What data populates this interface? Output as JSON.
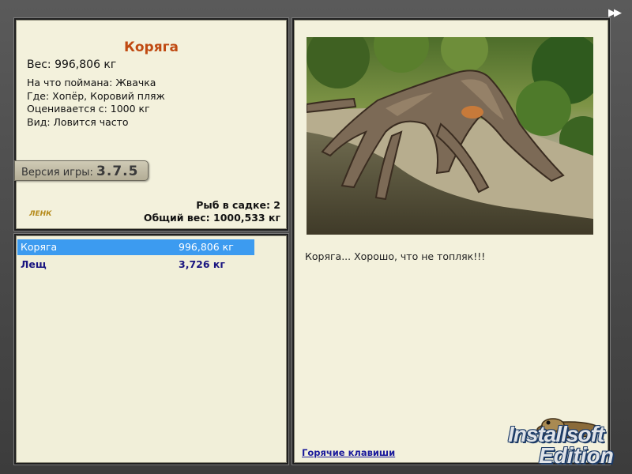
{
  "window": {
    "forward_glyph": "▶▶"
  },
  "info": {
    "title": "Коряга",
    "weight": "Вес: 996,806 кг",
    "details": [
      "На что поймана: Жвачка",
      "Где: Хопёр, Коровий пляж",
      "Оценивается с: 1000 кг",
      "Вид: Ловится часто"
    ],
    "version_label": "Версия игры:",
    "version_number": "3.7.5",
    "small_logo": "ЛЕНК",
    "fish_count": "Рыб в садке: 2",
    "total_weight": "Общий вес: 1000,533 кг"
  },
  "catch_list": [
    {
      "name": "Коряга",
      "weight": "996,806 кг",
      "selected": true
    },
    {
      "name": "Лещ",
      "weight": "3,726 кг",
      "selected": false
    }
  ],
  "photo_panel": {
    "photo_subject": "driftwood-snag-photo",
    "caption": "Коряга... Хорошо, что не топляк!!!",
    "hotkeys_link": "Горячие клавиши"
  },
  "branding": {
    "line1": "Installsoft",
    "line2": "Edition"
  },
  "colors": {
    "title": "#c04a12",
    "selection": "#3c9bf0",
    "list_text": "#1a1580",
    "panel_bg": "#f3f1dc"
  }
}
